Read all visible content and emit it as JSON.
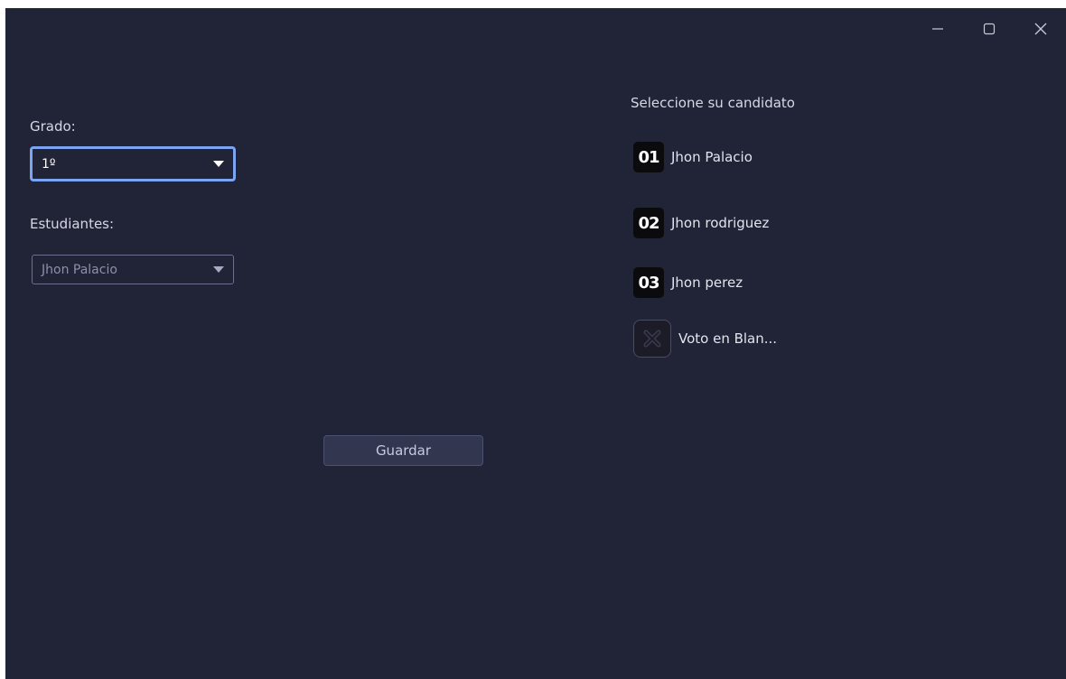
{
  "window": {
    "controls": {
      "minimize": "minimize-icon",
      "maximize": "maximize-icon",
      "close": "close-icon"
    }
  },
  "form": {
    "grade_label": "Grado:",
    "grade_value": "1º",
    "students_label": "Estudiantes:",
    "student_value": "Jhon Palacio",
    "save_label": "Guardar"
  },
  "candidates": {
    "heading": "Seleccione su candidato",
    "items": [
      {
        "number": "01",
        "name": "Jhon Palacio"
      },
      {
        "number": "02",
        "name": "Jhon rodriguez"
      },
      {
        "number": "03",
        "name": "Jhon perez"
      },
      {
        "icon": "blank-vote-x-icon",
        "name": "Voto en Blan..."
      }
    ]
  },
  "colors": {
    "background": "#212336",
    "focus_border": "#7ca4f2",
    "button_bg": "#33364f"
  }
}
